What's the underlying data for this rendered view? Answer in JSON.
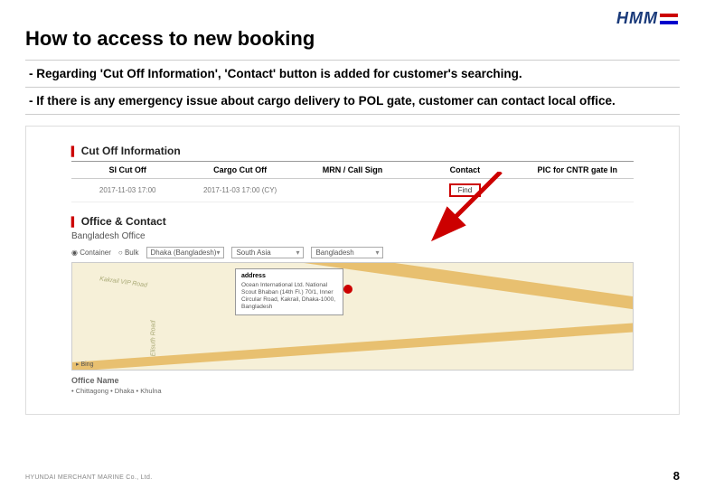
{
  "logo": "HMM",
  "title": "How to access to new booking",
  "bullets": [
    "-  Regarding 'Cut Off Information', 'Contact' button is added for customer's searching.",
    "-  If there is any emergency issue about cargo delivery to POL gate, customer can contact local office."
  ],
  "cutoff": {
    "heading": "Cut Off Information",
    "cols": [
      "SI Cut Off",
      "Cargo Cut Off",
      "MRN / Call Sign",
      "Contact",
      "PIC for CNTR gate In"
    ],
    "row": {
      "si": "2017-11-03 17:00",
      "cargo": "2017-11-03 17:00 (CY)",
      "mrn": "",
      "contact_btn": "Find",
      "pic": ""
    }
  },
  "office": {
    "heading": "Office & Contact",
    "sub": "Bangladesh Office",
    "radio1": "Container",
    "radio2": "Bulk",
    "sel1": "Dhaka (Bangladesh)",
    "sel2": "South Asia",
    "sel3": "Bangladesh",
    "roads": {
      "r1": "Kakrail VIP Road",
      "r2": "Elisuth Road"
    },
    "callout_title": "address",
    "callout_body": "Ocean International Ltd. National Scout Bhaban (14th Fl.) 70/1, Inner Circular Road, Kakrail, Dhaka-1000, Bangladesh",
    "bing": "▸ Bing",
    "office_name": "Office Name",
    "cities": "• Chittagong        • Dhaka        • Khulna"
  },
  "footer": "HYUNDAI MERCHANT MARINE Co., Ltd.",
  "page": "8"
}
